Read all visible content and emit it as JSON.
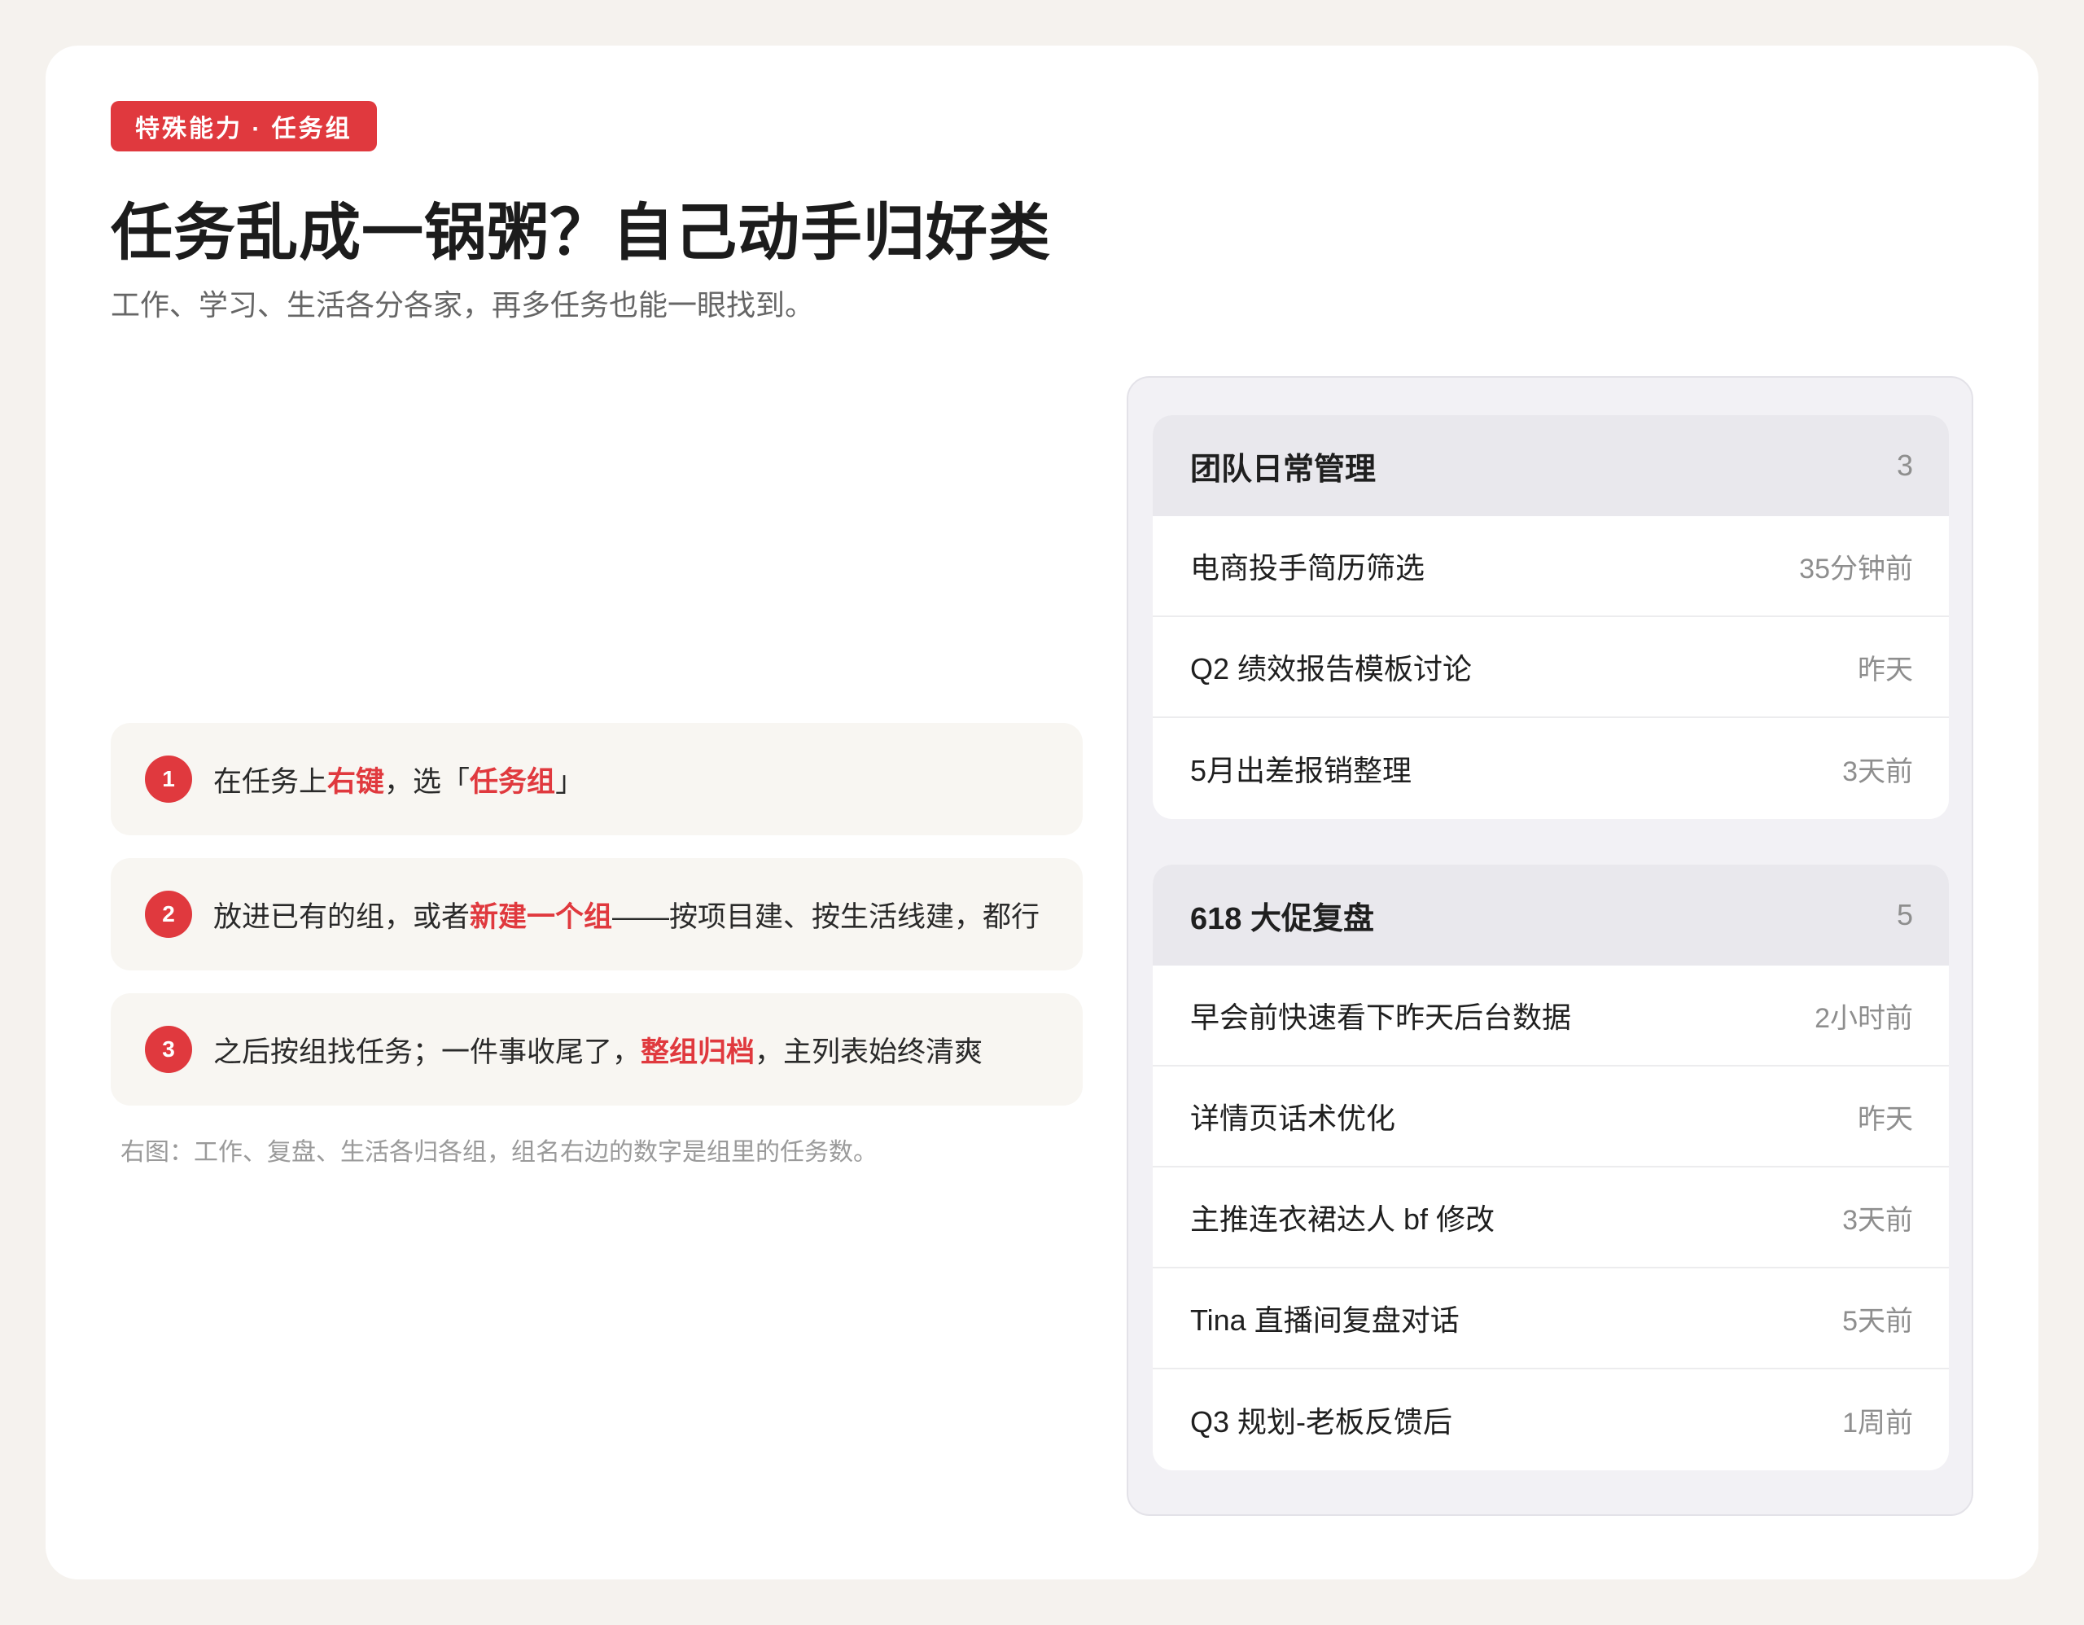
{
  "badge": "特殊能力 · 任务组",
  "title": "任务乱成一锅粥？自己动手归好类",
  "subtitle": "工作、学习、生活各分各家，再多任务也能一眼找到。",
  "steps": [
    {
      "num": "1",
      "p1": "在任务上",
      "h1": "右键",
      "p2": "，选「",
      "h2": "任务组",
      "p3": "」"
    },
    {
      "num": "2",
      "p1": "放进已有的组，或者",
      "h1": "新建一个组",
      "p2": "——按项目建、按生活线建，都行"
    },
    {
      "num": "3",
      "p1": "之后按组找任务；一件事收尾了，",
      "h1": "整组归档",
      "p2": "，主列表始终清爽"
    }
  ],
  "caption": "右图：工作、复盘、生活各归各组，组名右边的数字是组里的任务数。",
  "groups": [
    {
      "name": "团队日常管理",
      "count": "3",
      "tasks": [
        {
          "name": "电商投手简历筛选",
          "time": "35分钟前"
        },
        {
          "name": "Q2 绩效报告模板讨论",
          "time": "昨天"
        },
        {
          "name": "5月出差报销整理",
          "time": "3天前"
        }
      ]
    },
    {
      "name": "618 大促复盘",
      "count": "5",
      "tasks": [
        {
          "name": "早会前快速看下昨天后台数据",
          "time": "2小时前"
        },
        {
          "name": "详情页话术优化",
          "time": "昨天"
        },
        {
          "name": "主推连衣裙达人 bf 修改",
          "time": "3天前"
        },
        {
          "name": "Tina 直播间复盘对话",
          "time": "5天前"
        },
        {
          "name": "Q3 规划-老板反馈后",
          "time": "1周前"
        }
      ]
    }
  ]
}
